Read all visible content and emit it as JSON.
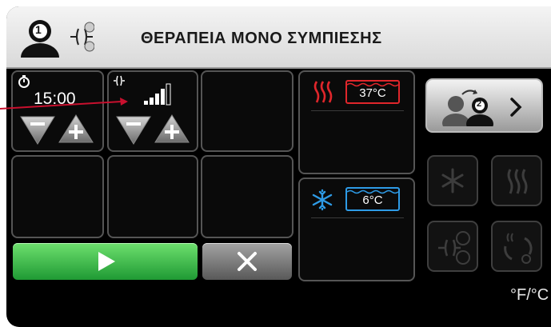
{
  "header": {
    "title": "ΘΕΡΑΠΕΙΑ ΜΟΝΟ ΣΥΜΠΙΕΣΗΣ",
    "user_number": "1",
    "mode_icon": "compression-heat-cold-icon"
  },
  "timer": {
    "icon": "stopwatch-icon",
    "value": "15:00",
    "decrement_label": "−",
    "increment_label": "+"
  },
  "compression": {
    "icon": "compression-icon",
    "level_bars_filled": 4,
    "level_bars_total": 5,
    "decrement_label": "−",
    "increment_label": "+"
  },
  "heat": {
    "icon": "heat-waves-icon",
    "temperature": "37°C",
    "color": "#e0262b"
  },
  "cold": {
    "icon": "snowflake-icon",
    "temperature": "6°C",
    "color": "#2e9be6"
  },
  "controls": {
    "start_icon": "play-icon",
    "stop_icon": "close-icon",
    "start_color": "#36b24a"
  },
  "side": {
    "next_user_number": "2",
    "next_icon": "switch-user-icon",
    "cold_mode_icon": "snowflake-icon",
    "heat_mode_icon": "heat-waves-icon",
    "combo_mode_icon": "compression-heat-cold-icon",
    "cycle_mode_icon": "heat-cold-cycle-icon"
  },
  "unit_toggle": "°F/°C"
}
